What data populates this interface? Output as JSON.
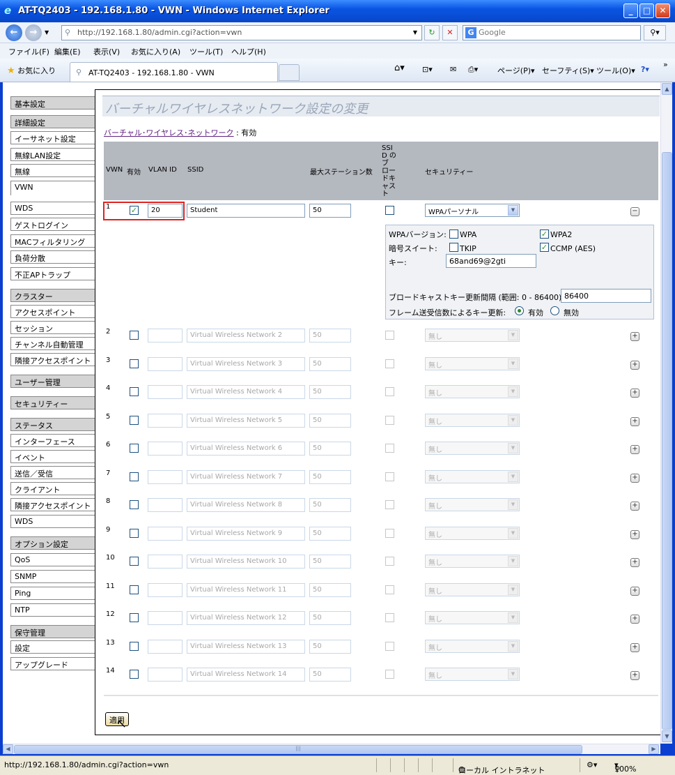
{
  "window": {
    "title": "AT-TQ2403 - 192.168.1.80 - VWN - Windows Internet Explorer"
  },
  "address": {
    "url": "http://192.168.1.80/admin.cgi?action=vwn"
  },
  "search": {
    "placeholder": "Google"
  },
  "menu": [
    "ファイル(F)",
    "編集(E)",
    "表示(V)",
    "お気に入り(A)",
    "ツール(T)",
    "ヘルプ(H)"
  ],
  "favorites": {
    "label": "お気に入り",
    "tab_title": "AT-TQ2403 - 192.168.1.80 - VWN"
  },
  "commandbar": {
    "page": "ページ(P)",
    "safety": "セーフティ(S)",
    "tools": "ツール(O)"
  },
  "sidebar": [
    {
      "label": "基本設定",
      "group": true
    },
    {
      "label": "詳細設定",
      "group": true
    },
    {
      "label": "イーサネット設定"
    },
    {
      "label": "無線LAN設定"
    },
    {
      "label": "無線"
    },
    {
      "label": "VWN",
      "active": true
    },
    {
      "label": "WDS"
    },
    {
      "label": "ゲストログイン"
    },
    {
      "label": "MACフィルタリング"
    },
    {
      "label": "負荷分散"
    },
    {
      "label": "不正APトラップ"
    },
    {
      "label": "クラスター",
      "group": true
    },
    {
      "label": "アクセスポイント"
    },
    {
      "label": "セッション"
    },
    {
      "label": "チャンネル自動管理"
    },
    {
      "label": "隣接アクセスポイント"
    },
    {
      "label": "ユーザー管理",
      "group": true
    },
    {
      "label": "セキュリティー",
      "group": true
    },
    {
      "label": "ステータス",
      "group": true
    },
    {
      "label": "インターフェース"
    },
    {
      "label": "イベント"
    },
    {
      "label": "送信／受信"
    },
    {
      "label": "クライアント"
    },
    {
      "label": "隣接アクセスポイント"
    },
    {
      "label": "WDS"
    },
    {
      "label": "オプション設定",
      "group": true
    },
    {
      "label": "QoS"
    },
    {
      "label": "SNMP"
    },
    {
      "label": "Ping"
    },
    {
      "label": "NTP"
    },
    {
      "label": "保守管理",
      "group": true
    },
    {
      "label": "設定"
    },
    {
      "label": "アップグレード"
    }
  ],
  "page": {
    "title": "バーチャルワイヤレスネットワーク設定の変更",
    "vwn_link": "バーチャル･ワイヤレス･ネットワーク",
    "vwn_link_suffix": " :",
    "vwn_status": "有効",
    "apply_label": "適用"
  },
  "table": {
    "headers": {
      "vwn": "VWN",
      "enabled": "有効",
      "vlan": "VLAN ID",
      "ssid": "SSID",
      "max_stations": "最大ステーション数",
      "broadcast": "SSID のブ ロー ドキ ャス ト",
      "security": "セキュリティー"
    },
    "rows": [
      {
        "num": "1",
        "enabled": true,
        "vlan": "20",
        "ssid": "Student",
        "max": "50",
        "broadcast": false,
        "security": "WPAパーソナル",
        "active": true
      },
      {
        "num": "2",
        "enabled": false,
        "vlan": "",
        "ssid": "Virtual Wireless Network 2",
        "max": "50",
        "broadcast": false,
        "security": "無し"
      },
      {
        "num": "3",
        "enabled": false,
        "vlan": "",
        "ssid": "Virtual Wireless Network 3",
        "max": "50",
        "broadcast": false,
        "security": "無し"
      },
      {
        "num": "4",
        "enabled": false,
        "vlan": "",
        "ssid": "Virtual Wireless Network 4",
        "max": "50",
        "broadcast": false,
        "security": "無し"
      },
      {
        "num": "5",
        "enabled": false,
        "vlan": "",
        "ssid": "Virtual Wireless Network 5",
        "max": "50",
        "broadcast": false,
        "security": "無し"
      },
      {
        "num": "6",
        "enabled": false,
        "vlan": "",
        "ssid": "Virtual Wireless Network 6",
        "max": "50",
        "broadcast": false,
        "security": "無し"
      },
      {
        "num": "7",
        "enabled": false,
        "vlan": "",
        "ssid": "Virtual Wireless Network 7",
        "max": "50",
        "broadcast": false,
        "security": "無し"
      },
      {
        "num": "8",
        "enabled": false,
        "vlan": "",
        "ssid": "Virtual Wireless Network 8",
        "max": "50",
        "broadcast": false,
        "security": "無し"
      },
      {
        "num": "9",
        "enabled": false,
        "vlan": "",
        "ssid": "Virtual Wireless Network 9",
        "max": "50",
        "broadcast": false,
        "security": "無し"
      },
      {
        "num": "10",
        "enabled": false,
        "vlan": "",
        "ssid": "Virtual Wireless Network 10",
        "max": "50",
        "broadcast": false,
        "security": "無し"
      },
      {
        "num": "11",
        "enabled": false,
        "vlan": "",
        "ssid": "Virtual Wireless Network 11",
        "max": "50",
        "broadcast": false,
        "security": "無し"
      },
      {
        "num": "12",
        "enabled": false,
        "vlan": "",
        "ssid": "Virtual Wireless Network 12",
        "max": "50",
        "broadcast": false,
        "security": "無し"
      },
      {
        "num": "13",
        "enabled": false,
        "vlan": "",
        "ssid": "Virtual Wireless Network 13",
        "max": "50",
        "broadcast": false,
        "security": "無し"
      },
      {
        "num": "14",
        "enabled": false,
        "vlan": "",
        "ssid": "Virtual Wireless Network 14",
        "max": "50",
        "broadcast": false,
        "security": "無し"
      }
    ]
  },
  "wpa": {
    "version_label": "WPAバージョン:",
    "wpa_label": "WPA",
    "wpa_checked": false,
    "wpa2_label": "WPA2",
    "wpa2_checked": true,
    "cipher_label": "暗号スイート:",
    "tkip_label": "TKIP",
    "tkip_checked": false,
    "ccmp_label": "CCMP (AES)",
    "ccmp_checked": true,
    "key_label": "キー:",
    "key_value": "68and69@2gti",
    "interval_label": "ブロードキャストキー更新間隔 (範囲: 0 - 86400):",
    "interval_value": "86400",
    "rekey_label": "フレーム送受信数によるキー更新:",
    "rekey_on": "有効",
    "rekey_off": "無効",
    "rekey_selected": "on"
  },
  "status": {
    "url": "http://192.168.1.80/admin.cgi?action=vwn",
    "zone": "ローカル イントラネット",
    "zoom": "100%"
  }
}
